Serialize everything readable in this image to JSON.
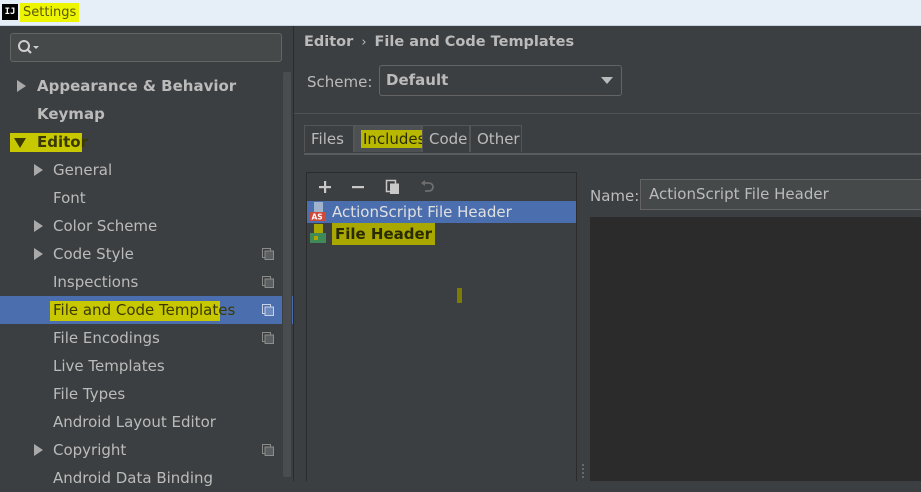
{
  "window": {
    "title": "Settings",
    "app_icon_text": "IJ"
  },
  "sidebar": {
    "search": {
      "value": "",
      "icon": "search-icon"
    },
    "items": [
      {
        "label": "Appearance & Behavior",
        "expandable": true,
        "expanded": false,
        "level": 0,
        "bold": true
      },
      {
        "label": "Keymap",
        "expandable": false,
        "level": 0,
        "bold": true
      },
      {
        "label": "Editor",
        "expandable": true,
        "expanded": true,
        "level": 0,
        "bold": true,
        "highlighted": true
      },
      {
        "label": "General",
        "expandable": true,
        "expanded": false,
        "level": 1
      },
      {
        "label": "Font",
        "expandable": false,
        "level": 1
      },
      {
        "label": "Color Scheme",
        "expandable": true,
        "expanded": false,
        "level": 1
      },
      {
        "label": "Code Style",
        "expandable": true,
        "expanded": false,
        "level": 1,
        "project_icon": true
      },
      {
        "label": "Inspections",
        "expandable": false,
        "level": 1,
        "project_icon": true
      },
      {
        "label": "File and Code Templates",
        "expandable": false,
        "level": 1,
        "project_icon": true,
        "selected": true,
        "highlighted": true
      },
      {
        "label": "File Encodings",
        "expandable": false,
        "level": 1,
        "project_icon": true
      },
      {
        "label": "Live Templates",
        "expandable": false,
        "level": 1
      },
      {
        "label": "File Types",
        "expandable": false,
        "level": 1
      },
      {
        "label": "Android Layout Editor",
        "expandable": false,
        "level": 1
      },
      {
        "label": "Copyright",
        "expandable": true,
        "expanded": false,
        "level": 1,
        "project_icon": true
      },
      {
        "label": "Android Data Binding",
        "expandable": false,
        "level": 1
      }
    ]
  },
  "breadcrumb": {
    "parent": "Editor",
    "separator": "›",
    "current": "File and Code Templates"
  },
  "scheme": {
    "label": "Scheme:",
    "value": "Default"
  },
  "tabs": [
    {
      "label": "Files",
      "active": false
    },
    {
      "label": "Includes",
      "active": true,
      "highlighted": true
    },
    {
      "label": "Code",
      "active": false
    },
    {
      "label": "Other",
      "active": false
    }
  ],
  "toolbar": {
    "add": "+",
    "remove": "−",
    "icons": [
      "plus-icon",
      "minus-icon",
      "copy-icon",
      "undo-icon"
    ]
  },
  "templates": [
    {
      "name": "ActionScript File Header",
      "icon_text": "AS",
      "selected": true
    },
    {
      "name": "File Header",
      "selected": false,
      "highlighted": true
    }
  ],
  "name_field": {
    "label": "Name:",
    "value": "ActionScript File Header"
  },
  "colors": {
    "background": "#3c3f41",
    "selection": "#4b6eaf",
    "highlight": "#c8c800",
    "editor_bg": "#2b2b2b"
  }
}
